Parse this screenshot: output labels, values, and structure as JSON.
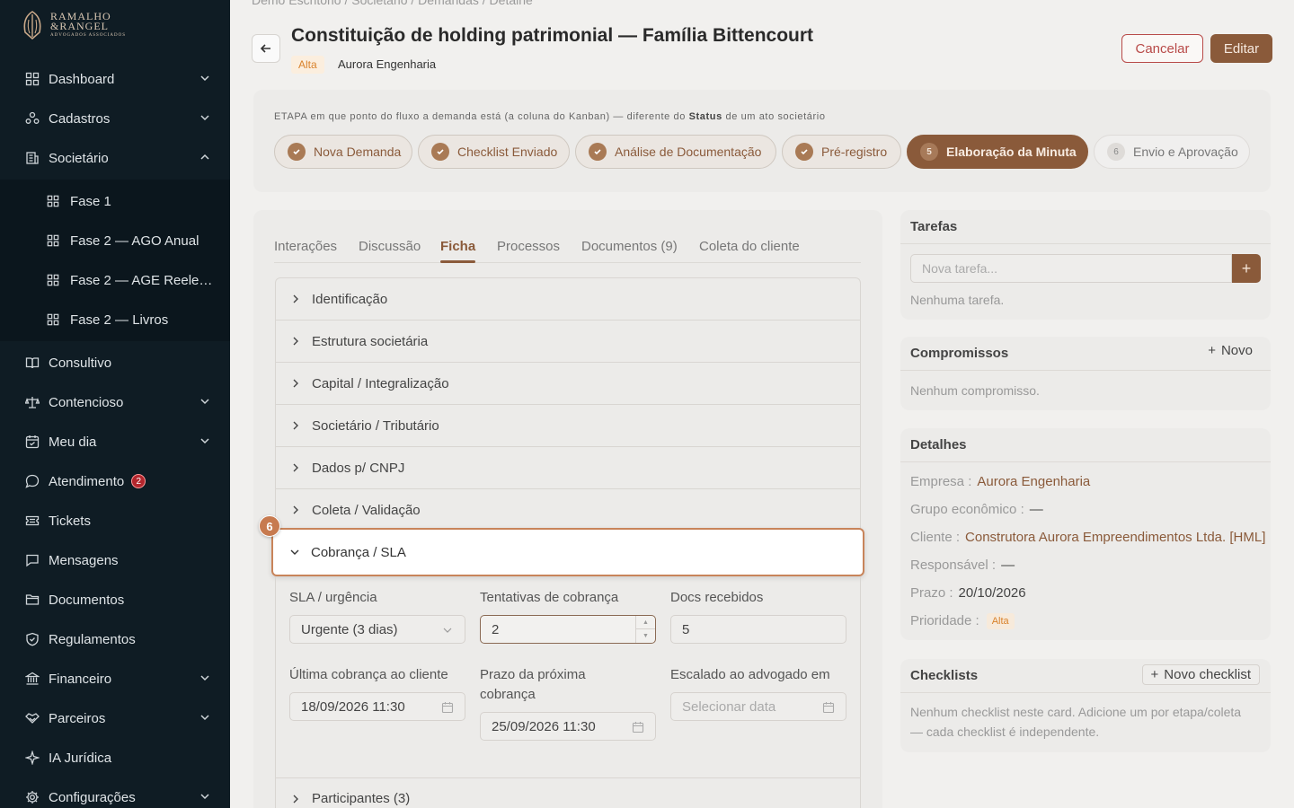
{
  "brand": {
    "line1": "RAMALHO",
    "line2": "&RANGEL",
    "line3": "ADVOGADOS ASSOCIADOS"
  },
  "sidebar": {
    "items": [
      {
        "label": "Dashboard",
        "icon": "grid-icon",
        "has_chevron": true
      },
      {
        "label": "Cadastros",
        "icon": "users-icon",
        "has_chevron": true
      },
      {
        "label": "Societário",
        "icon": "building-icon",
        "has_chevron": true,
        "expanded": true
      },
      {
        "label": "Consultivo",
        "icon": "book-icon"
      },
      {
        "label": "Contencioso",
        "icon": "scale-icon",
        "has_chevron": true
      },
      {
        "label": "Meu dia",
        "icon": "calendar-icon",
        "has_chevron": true
      },
      {
        "label": "Atendimento",
        "icon": "chat-icon",
        "badge": "2"
      },
      {
        "label": "Tickets",
        "icon": "ticket-icon"
      },
      {
        "label": "Mensagens",
        "icon": "message-icon"
      },
      {
        "label": "Documentos",
        "icon": "folder-icon"
      },
      {
        "label": "Regulamentos",
        "icon": "shield-icon"
      },
      {
        "label": "Financeiro",
        "icon": "bank-icon",
        "has_chevron": true
      },
      {
        "label": "Parceiros",
        "icon": "handshake-icon",
        "has_chevron": true
      },
      {
        "label": "IA Jurídica",
        "icon": "sparkle-icon"
      },
      {
        "label": "Configurações",
        "icon": "gear-icon",
        "has_chevron": true
      }
    ],
    "sub_items": [
      {
        "label": "Fase 1"
      },
      {
        "label": "Fase 2 — AGO Anual"
      },
      {
        "label": "Fase 2 — AGE Reeleição"
      },
      {
        "label": "Fase 2 — Livros"
      }
    ]
  },
  "breadcrumb": "Demo Escritório  /  Societário  /  Demandas  /  Detalhe",
  "header": {
    "title": "Constituição de holding patrimonial — Família Bittencourt",
    "priority": "Alta",
    "company": "Aurora Engenharia",
    "cancel_label": "Cancelar",
    "edit_label": "Editar"
  },
  "stages": {
    "note_prefix": "ETAPA",
    "note_middle": " em que ponto do fluxo a demanda está (a coluna do Kanban) — diferente do ",
    "note_bold": "Status",
    "note_suffix": " de um ato societário",
    "items": [
      {
        "label": "Nova Demanda",
        "state": "done"
      },
      {
        "label": "Checklist Enviado",
        "state": "done"
      },
      {
        "label": "Análise de Documentação",
        "state": "done"
      },
      {
        "label": "Pré-registro",
        "state": "done"
      },
      {
        "label": "Elaboração da Minuta",
        "state": "active",
        "number": "5"
      },
      {
        "label": "Envio e Aprovação",
        "state": "pending",
        "number": "6"
      }
    ]
  },
  "tabs": [
    "Interações",
    "Discussão",
    "Ficha",
    "Processos",
    "Documentos (9)",
    "Coleta do cliente"
  ],
  "active_tab": "Ficha",
  "sections": [
    "Identificação",
    "Estrutura societária",
    "Capital / Integralização",
    "Societário / Tributário",
    "Dados p/ CNPJ",
    "Coleta / Validação"
  ],
  "expanded_section": {
    "step": "6",
    "title": "Cobrança / SLA",
    "fields": {
      "sla_label": "SLA / urgência",
      "sla_value": "Urgente (3 dias)",
      "tentativas_label": "Tentativas de cobrança",
      "tentativas_value": "2",
      "docs_label": "Docs recebidos",
      "docs_value": "5",
      "ultima_label": "Última cobrança ao cliente",
      "ultima_value": "18/09/2026 11:30",
      "prazo_label": "Prazo da próxima cobrança",
      "prazo_value": "25/09/2026 11:30",
      "escalado_label": "Escalado ao advogado em",
      "escalado_placeholder": "Selecionar data"
    }
  },
  "last_section": "Participantes (3)",
  "tarefas": {
    "title": "Tarefas",
    "placeholder": "Nova tarefa...",
    "empty": "Nenhuma tarefa."
  },
  "compromissos": {
    "title": "Compromissos",
    "new_label": "Novo",
    "empty": "Nenhum compromisso."
  },
  "detalhes": {
    "title": "Detalhes",
    "rows": [
      {
        "label": "Empresa :",
        "value": "Aurora Engenharia"
      },
      {
        "label": "Grupo econômico :",
        "value": "—"
      },
      {
        "label": "Cliente :",
        "value": "Construtora Aurora Empreendimentos Ltda. [HML]"
      },
      {
        "label": "Responsável :",
        "value": "—"
      },
      {
        "label": "Prazo :",
        "value": "20/10/2026"
      },
      {
        "label": "Prioridade :",
        "value": "Alta"
      }
    ]
  },
  "checklists": {
    "title": "Checklists",
    "new_label": "Novo checklist",
    "empty_line1": "Nenhum checklist neste card. Adicione um por etapa/coleta",
    "empty_line2": "— cada checklist é independente."
  },
  "colors": {
    "sidebar_bg": "#0f1c24",
    "accent": "#8a5a3a",
    "danger": "#b84a48",
    "priority": "#d9822b"
  }
}
